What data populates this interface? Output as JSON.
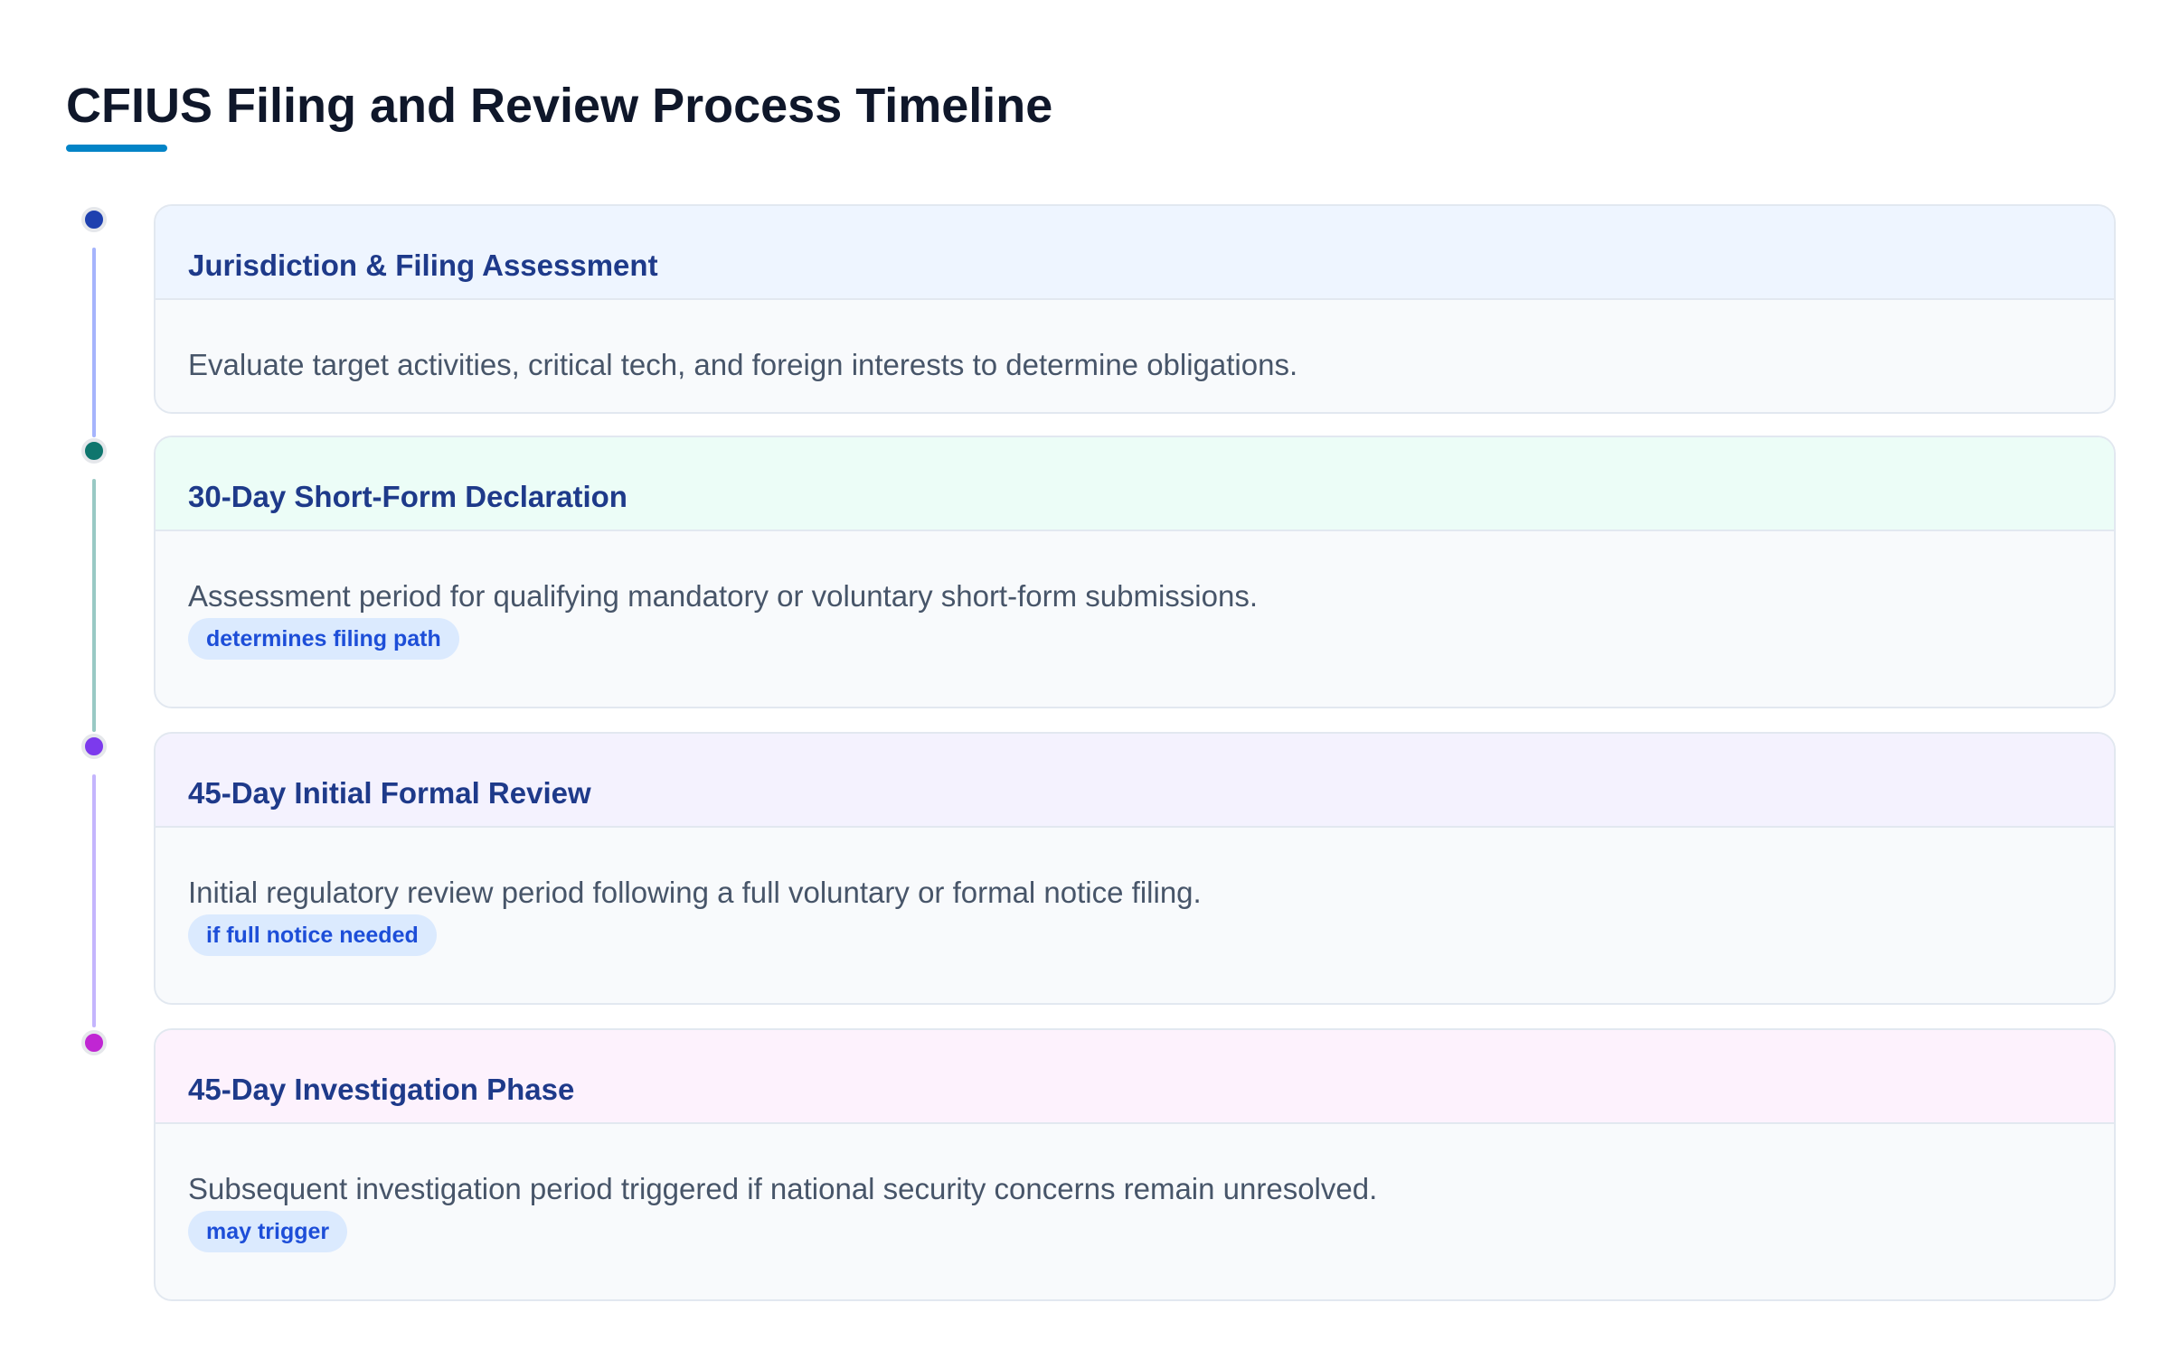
{
  "title": "CFIUS Filing and Review Process Timeline",
  "colors": {
    "title_underline": "#0284c7",
    "card_border": "#e2e8f0",
    "card_body_bg": "#f8fafc",
    "step_title": "#1e3a8a",
    "description": "#475569",
    "badge_bg": "#dbeafe",
    "badge_text": "#1d4ed8"
  },
  "steps": [
    {
      "title": "Jurisdiction & Filing Assessment",
      "description": "Evaluate target activities, critical tech, and foreign interests to determine obligations.",
      "badge": "",
      "dot_color": "#1e40af",
      "line_color": "#a5b4fc",
      "header_bg": "#eef5ff"
    },
    {
      "title": "30-Day Short-Form Declaration",
      "description": "Assessment period for qualifying mandatory or voluntary short-form submissions.",
      "badge": "determines filing path",
      "dot_color": "#0f766e",
      "line_color": "#99c9c4",
      "header_bg": "#ecfdf7"
    },
    {
      "title": "45-Day Initial Formal Review",
      "description": "Initial regulatory review period following a full voluntary or formal notice filing.",
      "badge": "if full notice needed",
      "dot_color": "#7c3aed",
      "line_color": "#c4b5fd",
      "header_bg": "#f4f2fe"
    },
    {
      "title": "45-Day Investigation Phase",
      "description": "Subsequent investigation period triggered if national security concerns remain unresolved.",
      "badge": "may trigger",
      "dot_color": "#c026d3",
      "line_color": "",
      "header_bg": "#fdf2fd"
    }
  ]
}
